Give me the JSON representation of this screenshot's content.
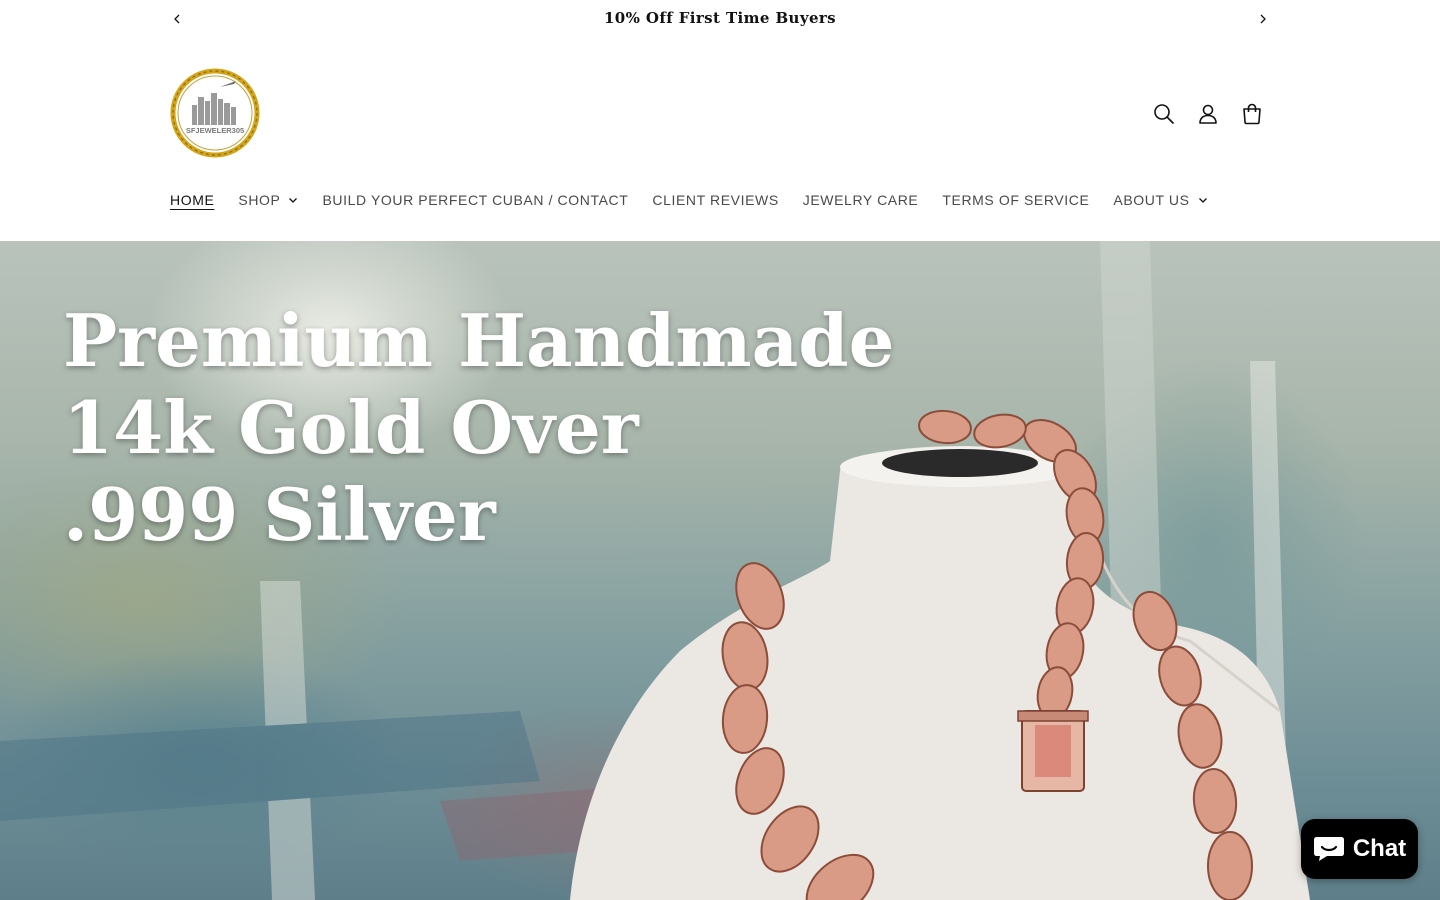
{
  "announcement": {
    "text": "10% Off First Time Buyers",
    "prev_icon": "chevron-left-icon",
    "next_icon": "chevron-right-icon"
  },
  "header": {
    "logo_text": "SFJEWELER305",
    "icons": [
      "search-icon",
      "account-icon",
      "cart-icon"
    ]
  },
  "nav": {
    "items": [
      {
        "label": "HOME",
        "active": true,
        "dropdown": false
      },
      {
        "label": "SHOP",
        "active": false,
        "dropdown": true
      },
      {
        "label": "BUILD YOUR PERFECT CUBAN / CONTACT",
        "active": false,
        "dropdown": false
      },
      {
        "label": "CLIENT REVIEWS",
        "active": false,
        "dropdown": false
      },
      {
        "label": "JEWELRY CARE",
        "active": false,
        "dropdown": false
      },
      {
        "label": "TERMS OF SERVICE",
        "active": false,
        "dropdown": false
      },
      {
        "label": "ABOUT US",
        "active": false,
        "dropdown": true
      }
    ]
  },
  "hero": {
    "line1": "Premium Handmade",
    "line2": "14k Gold Over",
    "line3": ".999 Silver"
  },
  "chat": {
    "label": "Chat",
    "icon": "chat-bubble-icon"
  },
  "colors": {
    "text": "#121212",
    "nav_text": "#4a4a4a",
    "chat_bg": "#000000",
    "rose_gold": "#d99a86"
  }
}
